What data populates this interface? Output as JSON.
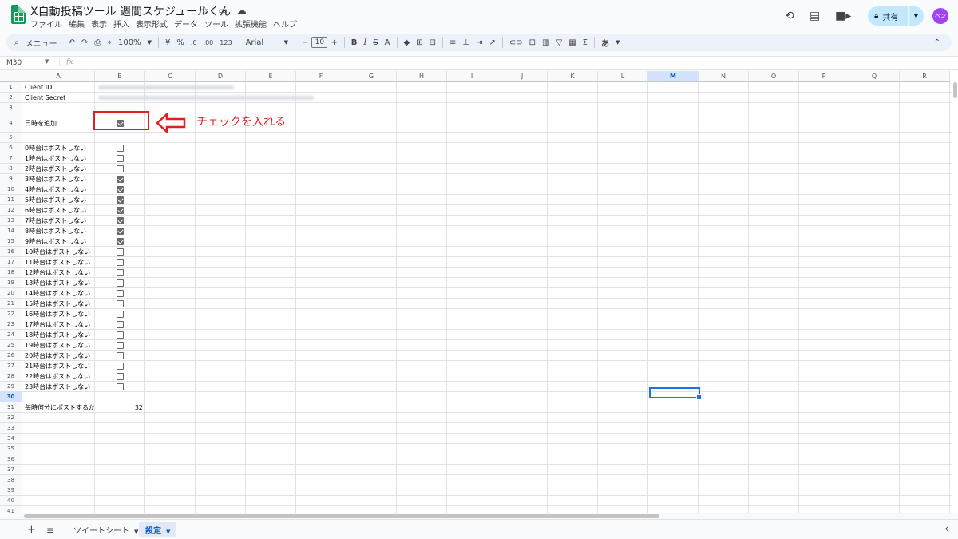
{
  "header": {
    "title": "X自動投稿ツール 週間スケジュールくん",
    "menu": [
      "ファイル",
      "編集",
      "表示",
      "挿入",
      "表示形式",
      "データ",
      "ツール",
      "拡張機能",
      "ヘルプ"
    ],
    "share_label": "共有",
    "avatar_text": "ペン"
  },
  "toolbar": {
    "search_label": "メニュー",
    "zoom": "100%",
    "currency": "¥",
    "percent": "%",
    "decimal_dec": ".0",
    "decimal_inc": ".00",
    "number_format": "123",
    "font": "Arial",
    "font_size": "10",
    "bold": "B",
    "italic": "I",
    "strike": "S",
    "text_color": "A",
    "sigma": "Σ",
    "input_tools": "あ"
  },
  "formula_bar": {
    "name_box": "M30",
    "fx": "fx"
  },
  "columns": [
    "A",
    "B",
    "C",
    "D",
    "E",
    "F",
    "G",
    "H",
    "I",
    "J",
    "K",
    "L",
    "M",
    "N",
    "O",
    "P",
    "Q",
    "R"
  ],
  "selected_column": "M",
  "rows_count": 41,
  "selected_row": 30,
  "cells": {
    "a1": "Client ID",
    "a2": "Client Secret",
    "a4": "日時を追加",
    "a31": "毎時何分にポストするか",
    "b31": "32"
  },
  "hour_rows": [
    {
      "label": "0時台はポストしない",
      "checked": false
    },
    {
      "label": "1時台はポストしない",
      "checked": false
    },
    {
      "label": "2時台はポストしない",
      "checked": false
    },
    {
      "label": "3時台はポストしない",
      "checked": true
    },
    {
      "label": "4時台はポストしない",
      "checked": true
    },
    {
      "label": "5時台はポストしない",
      "checked": true
    },
    {
      "label": "6時台はポストしない",
      "checked": true
    },
    {
      "label": "7時台はポストしない",
      "checked": true
    },
    {
      "label": "8時台はポストしない",
      "checked": true
    },
    {
      "label": "9時台はポストしない",
      "checked": true
    },
    {
      "label": "10時台はポストしない",
      "checked": false
    },
    {
      "label": "11時台はポストしない",
      "checked": false
    },
    {
      "label": "12時台はポストしない",
      "checked": false
    },
    {
      "label": "13時台はポストしない",
      "checked": false
    },
    {
      "label": "14時台はポストしない",
      "checked": false
    },
    {
      "label": "15時台はポストしない",
      "checked": false
    },
    {
      "label": "16時台はポストしない",
      "checked": false
    },
    {
      "label": "17時台はポストしない",
      "checked": false
    },
    {
      "label": "18時台はポストしない",
      "checked": false
    },
    {
      "label": "19時台はポストしない",
      "checked": false
    },
    {
      "label": "20時台はポストしない",
      "checked": false
    },
    {
      "label": "21時台はポストしない",
      "checked": false
    },
    {
      "label": "22時台はポストしない",
      "checked": false
    },
    {
      "label": "23時台はポストしない",
      "checked": false
    }
  ],
  "add_datetime_checked": true,
  "annotation": "チェックを入れる",
  "sheets": [
    {
      "name": "ツイートシート",
      "active": false
    },
    {
      "name": "設定",
      "active": true
    }
  ],
  "colors": {
    "accent": "#1a73e8",
    "annotation": "#e02020",
    "share_bg": "#c2e7ff",
    "avatar": "#a142f4"
  }
}
